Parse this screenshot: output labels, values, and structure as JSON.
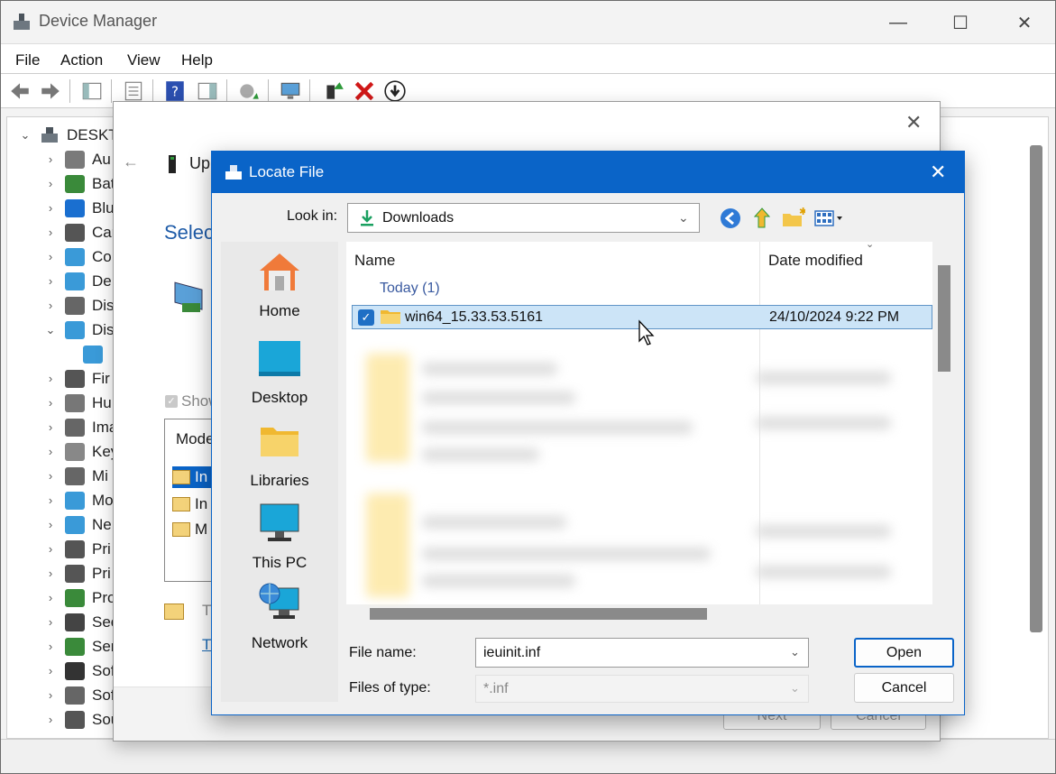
{
  "device_manager": {
    "title": "Device Manager",
    "window_controls": {
      "minimize": "—",
      "maximize": "☐",
      "close": "✕"
    },
    "menu": [
      "File",
      "Action",
      "View",
      "Help"
    ],
    "tree": {
      "root": "DESKT",
      "items": [
        {
          "label": "Au",
          "expanded": false
        },
        {
          "label": "Bat",
          "expanded": false
        },
        {
          "label": "Blu",
          "expanded": false
        },
        {
          "label": "Car",
          "expanded": false
        },
        {
          "label": "Co",
          "expanded": false
        },
        {
          "label": "De",
          "expanded": false
        },
        {
          "label": "Dis",
          "expanded": false
        },
        {
          "label": "Dis",
          "expanded": true
        },
        {
          "label": "",
          "expanded": false
        },
        {
          "label": "Fir",
          "expanded": false
        },
        {
          "label": "Hu",
          "expanded": false
        },
        {
          "label": "Ima",
          "expanded": false
        },
        {
          "label": "Key",
          "expanded": false
        },
        {
          "label": "Mi",
          "expanded": false
        },
        {
          "label": "Mo",
          "expanded": false
        },
        {
          "label": "Ne",
          "expanded": false
        },
        {
          "label": "Pri",
          "expanded": false
        },
        {
          "label": "Pri",
          "expanded": false
        },
        {
          "label": "Pro",
          "expanded": false
        },
        {
          "label": "Sec",
          "expanded": false
        },
        {
          "label": "Ser",
          "expanded": false
        },
        {
          "label": "Sof",
          "expanded": false
        },
        {
          "label": "Sof",
          "expanded": false
        },
        {
          "label": "Sou",
          "expanded": false
        }
      ]
    }
  },
  "wizard": {
    "back": "←",
    "title": "Up",
    "heading": "Selec",
    "show_compatible": "Show",
    "list_header": "Mode",
    "list_items": [
      "In",
      "In",
      "M"
    ],
    "tell_text": "T",
    "link_text": "T",
    "next_label": "Next",
    "cancel_label": "Cancel"
  },
  "locate_file": {
    "title": "Locate File",
    "close": "✕",
    "look_in_label": "Look in:",
    "look_in_value": "Downloads",
    "places": [
      "Home",
      "Desktop",
      "Libraries",
      "This PC",
      "Network"
    ],
    "columns": {
      "name": "Name",
      "date": "Date modified"
    },
    "group_label": "Today (1)",
    "selected_row": {
      "name": "win64_15.33.53.5161",
      "date": "24/10/2024 9:22 PM"
    },
    "file_name_label": "File name:",
    "file_name_value": "ieuinit.inf",
    "files_of_type_label": "Files of type:",
    "files_of_type_value": "*.inf",
    "open_label": "Open",
    "cancel_label": "Cancel"
  }
}
